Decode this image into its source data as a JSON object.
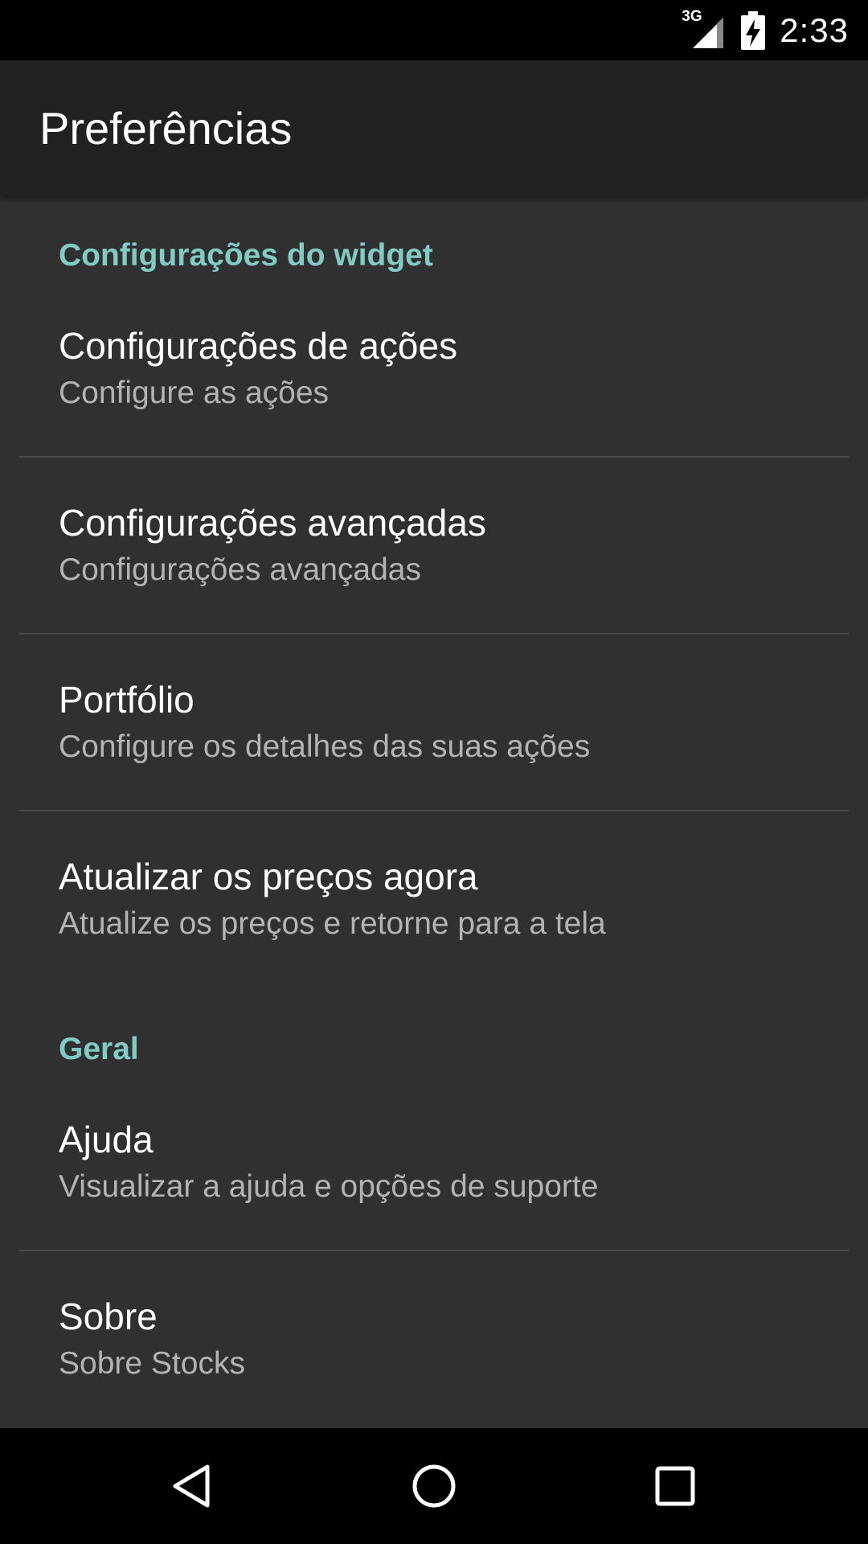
{
  "status_bar": {
    "network": "3G",
    "time": "2:33"
  },
  "app_bar": {
    "title": "Preferências"
  },
  "sections": [
    {
      "header": "Configurações do widget",
      "items": [
        {
          "title": "Configurações de ações",
          "summary": "Configure as ações"
        },
        {
          "title": "Configurações avançadas",
          "summary": "Configurações avançadas"
        },
        {
          "title": "Portfólio",
          "summary": "Configure os detalhes das suas ações"
        },
        {
          "title": "Atualizar os preços agora",
          "summary": "Atualize os preços e retorne para a tela"
        }
      ]
    },
    {
      "header": "Geral",
      "items": [
        {
          "title": "Ajuda",
          "summary": "Visualizar a ajuda e opções de suporte"
        },
        {
          "title": "Sobre",
          "summary": "Sobre Stocks"
        }
      ]
    }
  ],
  "nav_bar": {
    "icons": [
      "back-icon",
      "home-icon",
      "recents-icon"
    ]
  },
  "colors": {
    "accent": "#80cbc4",
    "background": "#303030",
    "app_bar": "#212121"
  }
}
